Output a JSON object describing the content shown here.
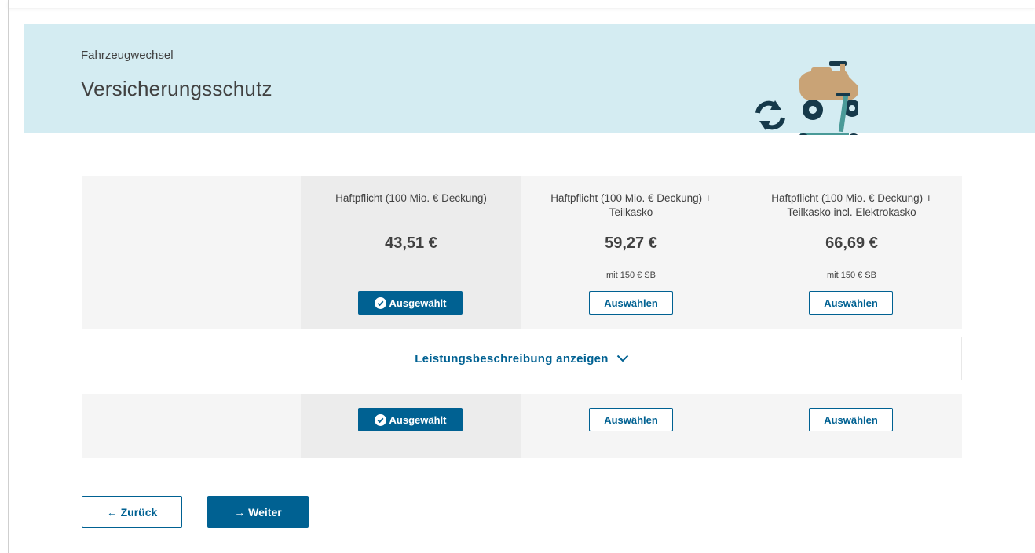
{
  "header": {
    "overline": "Fahrzeugwechsel",
    "title": "Versicherungsschutz",
    "illustration_icon": "vehicle-swap-icon"
  },
  "plans": [
    {
      "name": "Haftpflicht (100 Mio. € Deckung)",
      "price": "43,51 €",
      "deductible": "",
      "button": "Ausgewählt",
      "selected": true
    },
    {
      "name": "Haftpflicht (100 Mio. € Deckung) + Teilkasko",
      "price": "59,27 €",
      "deductible": "mit 150 € SB",
      "button": "Auswählen",
      "selected": false
    },
    {
      "name": "Haftpflicht (100 Mio. € Deckung) + Teilkasko incl. Elektrokasko",
      "price": "66,69 €",
      "deductible": "mit 150 € SB",
      "button": "Auswählen",
      "selected": false
    }
  ],
  "details_toggle": {
    "label": "Leistungsbeschreibung anzeigen",
    "icon": "chevron-down-icon"
  },
  "bottom_row": {
    "buttons": [
      "Ausgewählt",
      "Auswählen",
      "Auswählen"
    ]
  },
  "nav": {
    "back_label": "← Zurück",
    "next_label": "→ Weiter"
  },
  "colors": {
    "primary": "#006192",
    "banner": "#d4ecf2",
    "table_bg": "#f5f5f5",
    "selected_col_bg": "#ececec"
  }
}
